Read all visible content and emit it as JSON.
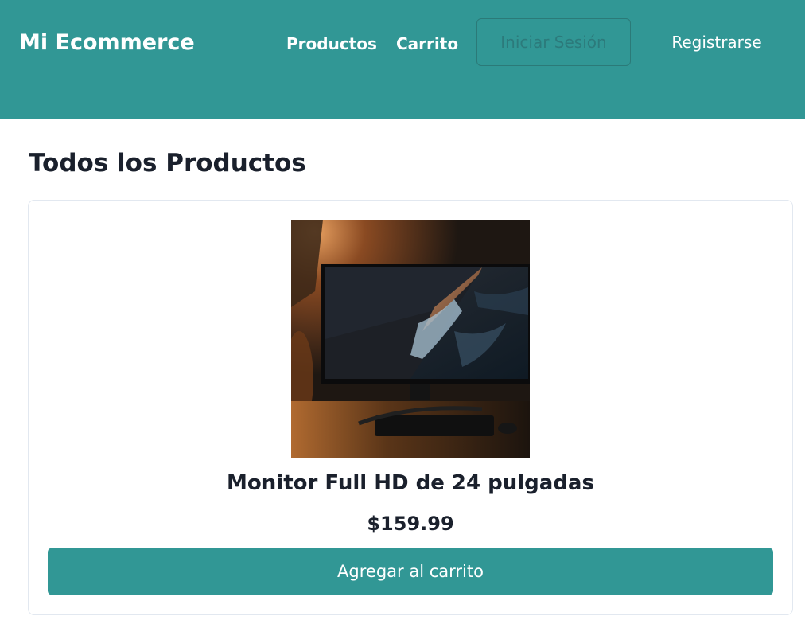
{
  "navbar": {
    "brand": "Mi Ecommerce",
    "links": [
      {
        "label": "Productos"
      },
      {
        "label": "Carrito"
      }
    ],
    "login_label": "Iniciar Sesión",
    "register_label": "Registrarse",
    "background_color": "#319795"
  },
  "main": {
    "title": "Todos los Productos",
    "products": [
      {
        "name": "Monitor Full HD de 24 pulgadas",
        "price": "$159.99",
        "add_to_cart_label": "Agregar al carrito"
      }
    ]
  },
  "colors": {
    "accent": "#319795",
    "text": "#1a202c",
    "card_border": "#e2e8f0"
  }
}
